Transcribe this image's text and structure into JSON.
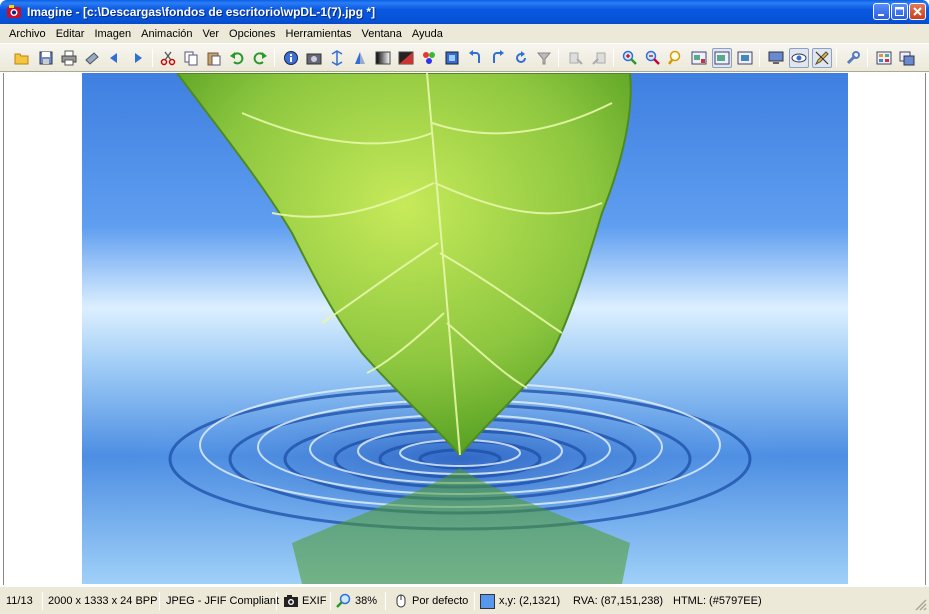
{
  "window": {
    "title": "Imagine - [c:\\Descargas\\fondos de escritorio\\wpDL-1(7).jpg *]"
  },
  "menu": [
    "Archivo",
    "Editar",
    "Imagen",
    "Animación",
    "Ver",
    "Opciones",
    "Herramientas",
    "Ventana",
    "Ayuda"
  ],
  "toolbar": {
    "icons": [
      "open-icon",
      "save-icon",
      "print-icon",
      "scan-icon",
      "previous-icon",
      "next-icon",
      "cut-icon",
      "copy-icon",
      "paste-icon",
      "undo-icon",
      "redo-icon",
      "info-icon",
      "capture-icon",
      "resize-icon",
      "flip-icon",
      "gradient-icon",
      "color-icon",
      "effects-icon",
      "select-icon",
      "rotate-left-icon",
      "rotate-right-icon",
      "rotate-icon",
      "filter-icon",
      "zoom-in-icon",
      "zoom-out-icon",
      "zoom-fit-icon",
      "fullscreen-icon",
      "window-fit-icon",
      "monitor-icon",
      "view-icon",
      "edit-icon",
      "tools-icon",
      "thumbnails-icon",
      "slideshow-icon"
    ]
  },
  "status": {
    "index": "11/13",
    "dimensions": "2000 x 1333 x 24 BPP",
    "format": "JPEG - JFIF Compliant",
    "exif": "EXIF",
    "zoom": "38%",
    "mode": "Por defecto",
    "coords": "x,y: (2,1321)",
    "rgb": "RVA: (87,151,238)",
    "html_color": "HTML: (#5797EE)",
    "swatch_color": "#5797EE"
  },
  "colors": {
    "titlebar": "#0553D8",
    "sky_top": "#3f7fe0",
    "water": "#4a8fe0",
    "leaf": "#8cc63f"
  }
}
